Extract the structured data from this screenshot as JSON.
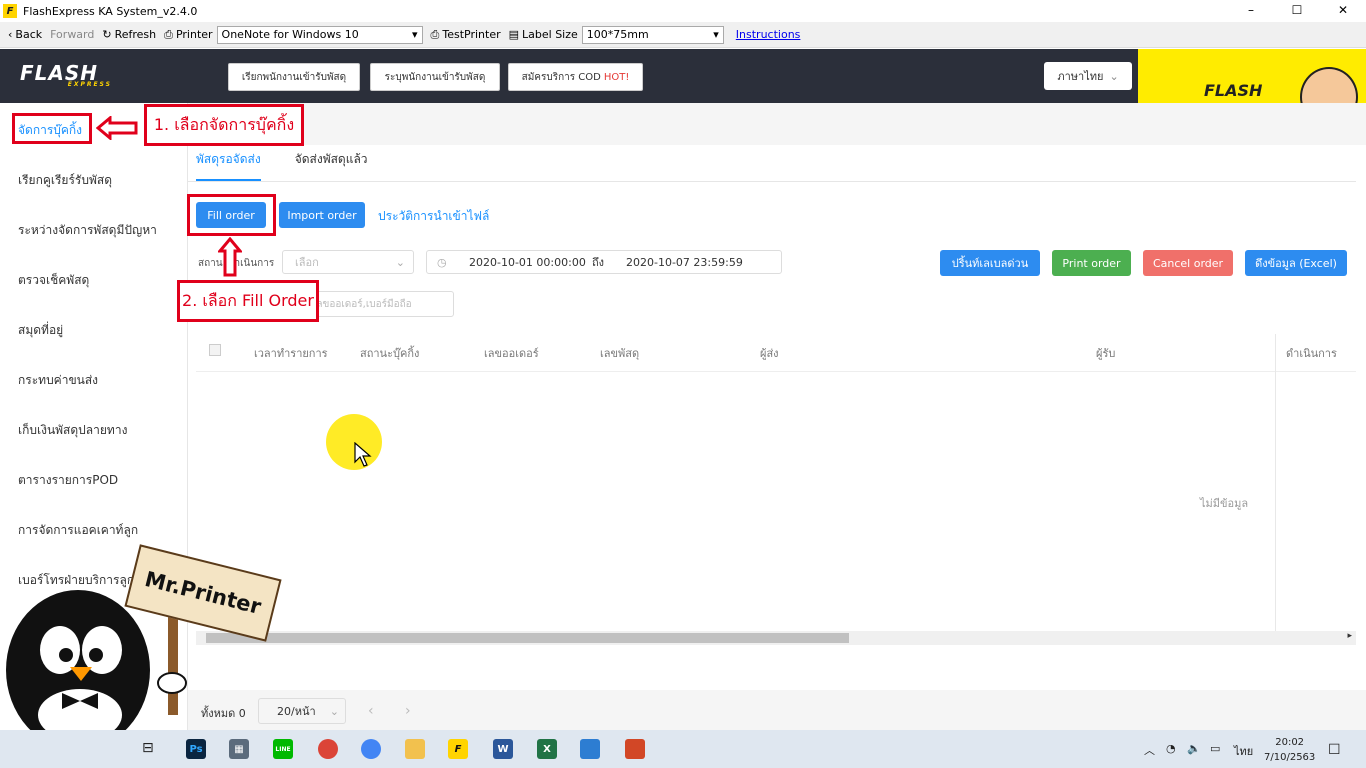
{
  "window": {
    "title": "FlashExpress KA System_v2.4.0",
    "minimize": "–",
    "maximize": "☐",
    "close": "✕"
  },
  "toolbar": {
    "back": "Back",
    "forward": "Forward",
    "refresh": "Refresh",
    "printer_label": "Printer",
    "printer_value": "OneNote for Windows 10",
    "test_printer": "TestPrinter",
    "label_size_label": "Label Size",
    "label_size_value": "100*75mm",
    "instructions": "Instructions"
  },
  "header": {
    "brand": "FLASH",
    "brand_sub": "EXPRESS",
    "btn1": "เรียกพนักงานเข้ารับพัสดุ",
    "btn2": "ระบุพนักงานเข้ารับพัสดุ",
    "btn3": "สมัครบริการ COD",
    "btn3_hot": "HOT!",
    "lang": "ภาษาไทย"
  },
  "banner": {
    "logo": "FLASH"
  },
  "sidebar": {
    "items": [
      {
        "label": "จัดการบุ๊คกิ้ง"
      },
      {
        "label": "เรียกคูเรียร์รับพัสดุ"
      },
      {
        "label": "ระหว่างจัดการพัสดุมีปัญหา"
      },
      {
        "label": "ตรวจเช็คพัสดุ"
      },
      {
        "label": "สมุดที่อยู่"
      },
      {
        "label": "กระทบค่าขนส่ง"
      },
      {
        "label": "เก็บเงินพัสดุปลายทาง"
      },
      {
        "label": "ตารางรายการPOD"
      },
      {
        "label": "การจัดการแอคเคาท์ลูก"
      },
      {
        "label": "เบอร์โทรฝ่ายบริการลูกค้า"
      }
    ]
  },
  "tabs": [
    {
      "label": "พัสดุรอจัดส่ง"
    },
    {
      "label": "จัดส่งพัสดุแล้ว"
    }
  ],
  "actions": {
    "fill_order": "Fill order",
    "import_order": "Import order",
    "import_history": "ประวัติการนำเข้าไฟล์",
    "print_urgent": "ปริ้นท์เลเบลด่วน",
    "print_order": "Print order",
    "cancel_order": "Cancel order",
    "export_excel": "ดึงข้อมูล (Excel)"
  },
  "filters": {
    "status_label": "สถานะดำเนินการ",
    "status_placeholder": "เลือก",
    "date_from": "2020-10-01 00:00:00",
    "date_to_label": "ถึง",
    "date_to": "2020-10-07 23:59:59",
    "search_placeholder": "เลขออเดอร์,เบอร์มือถือ"
  },
  "table": {
    "columns": [
      "เวลาทำรายการ",
      "สถานะบุ๊คกิ้ง",
      "เลขออเดอร์",
      "เลขพัสดุ",
      "ผู้ส่ง",
      "ผู้รับ",
      "ดำเนินการ"
    ],
    "empty_text": "ไม่มีข้อมูล"
  },
  "pagination": {
    "total": "ทั้งหมด 0",
    "page_size": "20/หน้า",
    "prev": "‹",
    "next": "›"
  },
  "annotations": {
    "step1": "1. เลือกจัดการบุ๊คกิ้ง",
    "step2": "2. เลือก Fill Order",
    "sign": "Mr.Printer"
  },
  "taskbar": {
    "apps": [
      "Ps",
      "LINE",
      "F",
      "W",
      "X"
    ],
    "lang": "ไทย",
    "time": "20:02",
    "date": "7/10/2563"
  },
  "colors": {
    "accent": "#1890ff",
    "header_bg": "#2b2f3a",
    "annotation": "#e0001b",
    "brand_yellow": "#ffec00"
  }
}
